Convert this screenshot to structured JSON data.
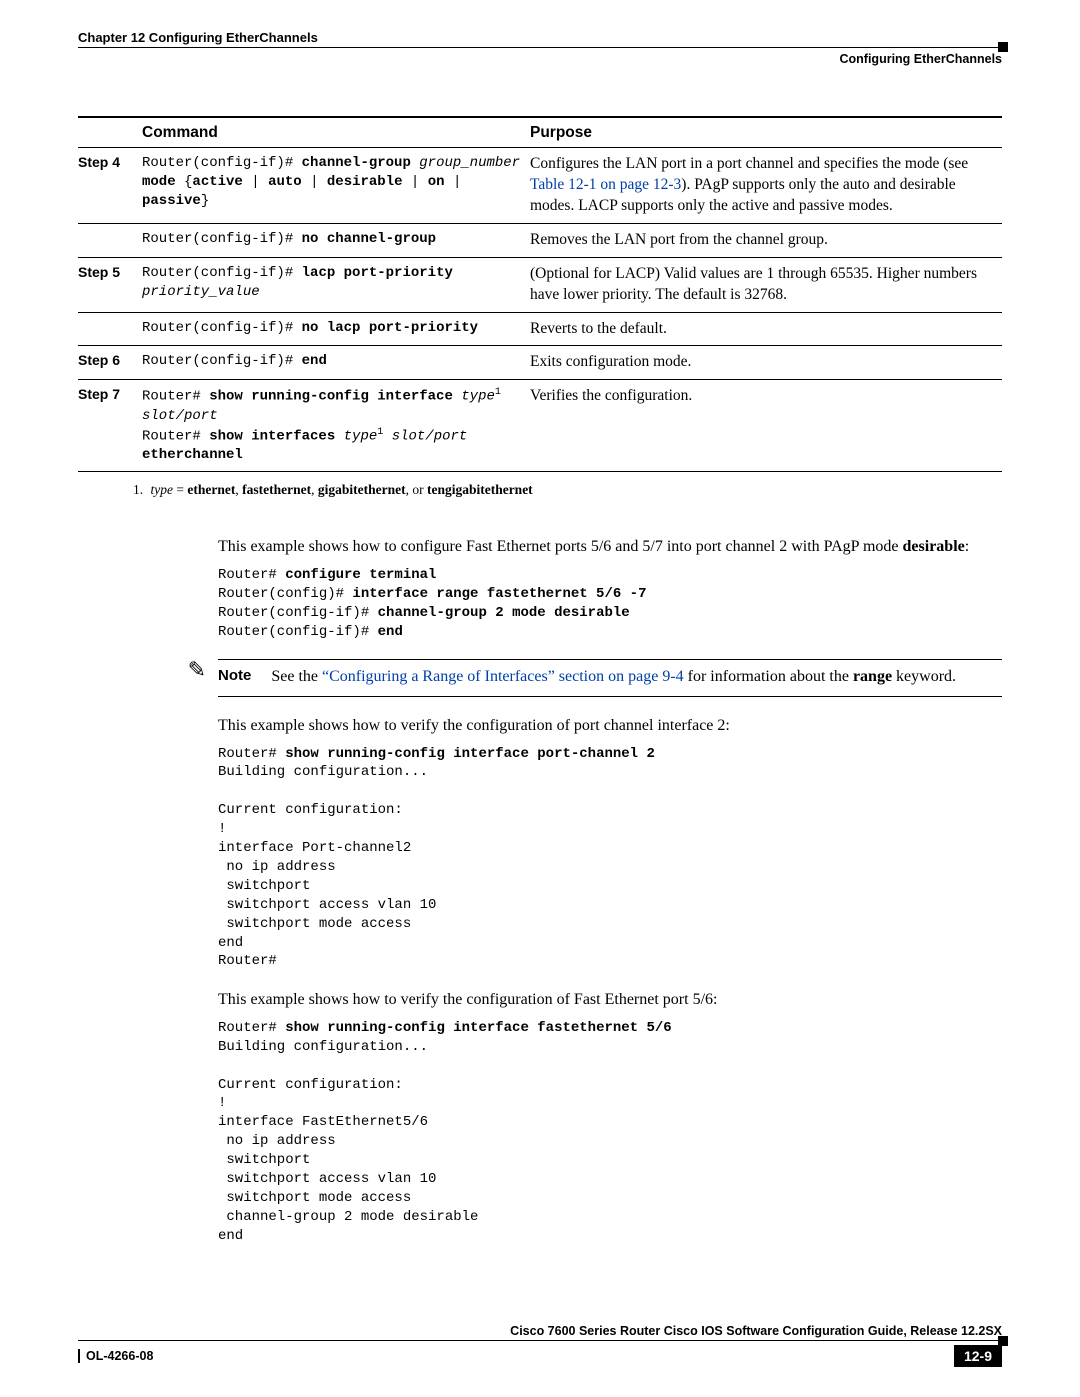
{
  "header": {
    "chapter": "Chapter 12    Configuring EtherChannels",
    "section": "Configuring EtherChannels"
  },
  "table": {
    "head_command": "Command",
    "head_purpose": "Purpose",
    "rows": [
      {
        "step": "Step 4",
        "cmd_html": "Router(config-if)# <b>channel-group</b> <i>group_number</i><br><b>mode</b> {<b>active</b> | <b>auto</b> | <b>desirable</b> | <b>on</b> | <b>passive</b>}",
        "purpose_pre": "Configures the LAN port in a port channel and specifies the mode (see ",
        "purpose_link": "Table 12-1 on page 12-3",
        "purpose_post": "). PAgP supports only the auto and desirable modes. LACP supports only the active and passive modes."
      },
      {
        "step": "",
        "cmd_html": "Router(config-if)# <b>no channel-group</b>",
        "purpose_pre": "Removes the LAN port from the channel group.",
        "purpose_link": "",
        "purpose_post": ""
      },
      {
        "step": "Step 5",
        "cmd_html": "Router(config-if)# <b>lacp port-priority</b><br><i>priority_value</i>",
        "purpose_pre": "(Optional for LACP) Valid values are 1 through 65535. Higher numbers have lower priority. The default is 32768.",
        "purpose_link": "",
        "purpose_post": ""
      },
      {
        "step": "",
        "cmd_html": "Router(config-if)# <b>no lacp port-priority</b>",
        "purpose_pre": "Reverts to the default.",
        "purpose_link": "",
        "purpose_post": ""
      },
      {
        "step": "Step 6",
        "cmd_html": "Router(config-if)# <b>end</b>",
        "purpose_pre": "Exits configuration mode.",
        "purpose_link": "",
        "purpose_post": ""
      },
      {
        "step": "Step 7",
        "cmd_html": "Router# <b>show running-config interface</b> <i>type</i><span class='sup'>1</span><br><i>slot/port</i><br>Router# <b>show interfaces</b> <i>type</i><span class='sup'>1</span> <i>slot/port</i><br><b>etherchannel</b>",
        "purpose_pre": "Verifies the configuration.",
        "purpose_link": "",
        "purpose_post": ""
      }
    ]
  },
  "footnote": {
    "num": "1.",
    "text_html": "<i>type</i> = <b>ethernet</b>, <b>fastethernet</b>, <b>gigabitethernet</b>, or <b>tengigabitethernet</b>"
  },
  "para1_html": "This example shows how to configure Fast Ethernet ports 5/6 and 5/7 into port channel 2 with PAgP mode <b>desirable</b>:",
  "code1_html": "Router# <b>configure terminal</b>\nRouter(config)# <b>interface range fastethernet 5/6 -7</b>\nRouter(config-if)# <b>channel-group 2 mode desirable</b>\nRouter(config-if)# <b>end</b>",
  "note": {
    "label": "Note",
    "pre": "See the ",
    "link": "“Configuring a Range of Interfaces” section on page 9-4",
    "post": " for information about the ",
    "bold": "range",
    "tail": " keyword."
  },
  "para2": "This example shows how to verify the configuration of port channel interface 2:",
  "code2_html": "Router# <b>show running-config interface port-channel 2</b>\nBuilding configuration...\n\nCurrent configuration:\n!\ninterface Port-channel2\n no ip address\n switchport\n switchport access vlan 10\n switchport mode access\nend\nRouter#",
  "para3": "This example shows how to verify the configuration of Fast Ethernet port 5/6:",
  "code3_html": "Router# <b>show running-config interface fastethernet 5/6</b>\nBuilding configuration...\n\nCurrent configuration:\n!\ninterface FastEthernet5/6\n no ip address\n switchport\n switchport access vlan 10\n switchport mode access\n channel-group 2 mode desirable\nend",
  "footer": {
    "guide": "Cisco 7600 Series Router Cisco IOS Software Configuration Guide, Release 12.2SX",
    "ol": "OL-4266-08",
    "page": "12-9"
  }
}
